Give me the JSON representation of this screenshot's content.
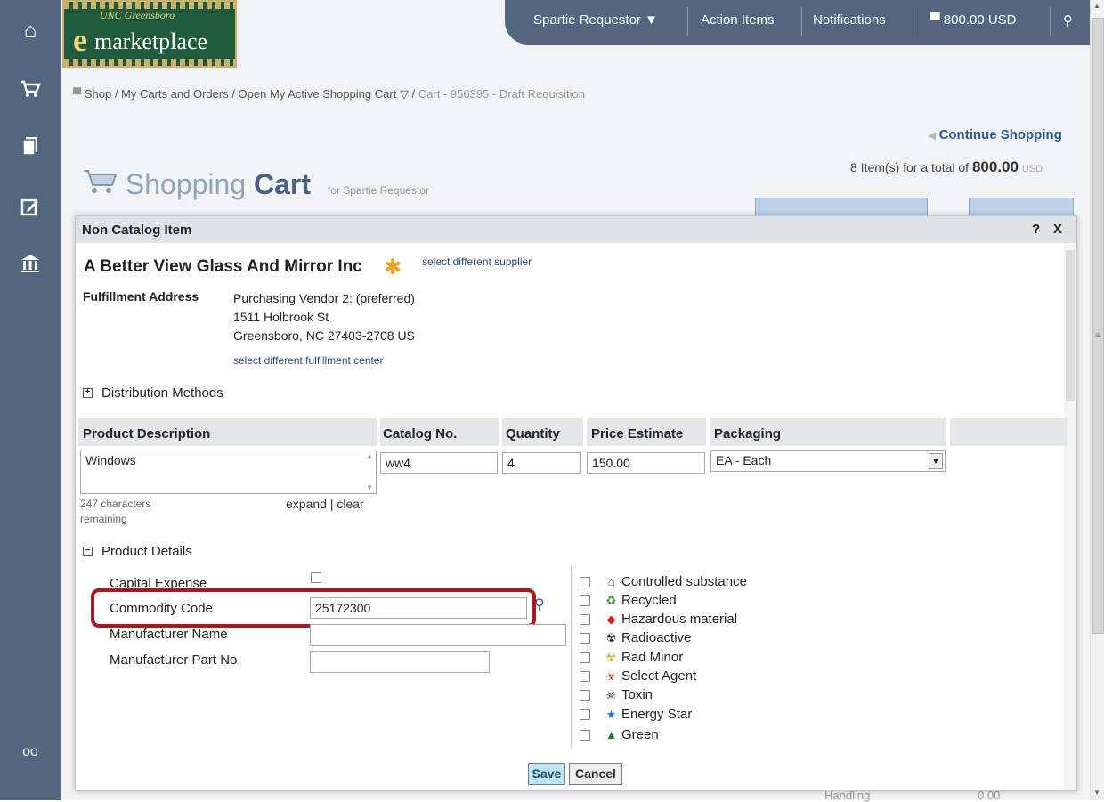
{
  "rail": {
    "icons": [
      "home-icon",
      "cart-icon",
      "documents-icon",
      "edit-icon",
      "bank-icon",
      "binoculars-icon"
    ]
  },
  "logo": {
    "sub": "UNC Greensboro",
    "e": "e",
    "main": "marketplace"
  },
  "topnav": {
    "user": "Spartie Requestor ▼",
    "action_items": "Action Items",
    "notifications": "Notifications",
    "cart_total": "800.00 USD"
  },
  "breadcrumb": {
    "shop": "Shop",
    "carts": "My Carts and Orders",
    "open_cart": "Open My Active Shopping Cart",
    "current": "Cart - 956395 - Draft Requisition"
  },
  "cart": {
    "continue": "Continue Shopping",
    "items_text": "8 Item(s)  for a total of",
    "total": "800.00",
    "currency": "USD",
    "title_light": "Shopping",
    "title_bold": "Cart",
    "for_text": "for Spartie Requestor"
  },
  "modal": {
    "title": "Non Catalog Item",
    "help": "?",
    "close": "X",
    "supplier": "A Better View Glass And Mirror Inc",
    "select_supplier": "select different supplier",
    "fulfillment_label": "Fulfillment Address",
    "fulfillment_lines": [
      "Purchasing Vendor 2: (preferred)",
      "1511 Holbrook St",
      "Greensboro, NC 27403-2708 US"
    ],
    "select_fulfillment": "select different fulfillment center",
    "distribution": "Distribution Methods",
    "table": {
      "headers": [
        "Product Description",
        "Catalog No.",
        "Quantity",
        "Price Estimate",
        "Packaging"
      ],
      "description": "Windows",
      "catalog_no": "ww4",
      "quantity": "4",
      "price": "150.00",
      "packaging": "EA - Each"
    },
    "remaining": "247 characters remaining",
    "remaining_l1": "247 characters",
    "remaining_l2": "remaining",
    "expand": "expand",
    "clear": "clear",
    "product_details": "Product Details",
    "details": {
      "capital_expense": "Capital Expense",
      "commodity_code": "Commodity Code",
      "commodity_value": "25172300",
      "manufacturer_name": "Manufacturer Name",
      "manufacturer_part": "Manufacturer Part No"
    },
    "attributes": [
      {
        "label": "Controlled substance",
        "icon": "controlled-substance-icon",
        "glyph": "⌂",
        "color": "#3a3a8a"
      },
      {
        "label": "Recycled",
        "icon": "recycled-icon",
        "glyph": "♻",
        "color": "#2a9a2a"
      },
      {
        "label": "Hazardous material",
        "icon": "hazardous-icon",
        "glyph": "◆",
        "color": "#d02020"
      },
      {
        "label": "Radioactive",
        "icon": "radioactive-icon",
        "glyph": "☢",
        "color": "#222"
      },
      {
        "label": "Rad Minor",
        "icon": "rad-minor-icon",
        "glyph": "☢",
        "color": "#c9b030"
      },
      {
        "label": "Select Agent",
        "icon": "select-agent-icon",
        "glyph": "☣",
        "color": "#b02020"
      },
      {
        "label": "Toxin",
        "icon": "toxin-icon",
        "glyph": "☠",
        "color": "#222"
      },
      {
        "label": "Energy Star",
        "icon": "energy-star-icon",
        "glyph": "★",
        "color": "#1a7ac9"
      },
      {
        "label": "Green",
        "icon": "green-icon",
        "glyph": "▲",
        "color": "#1a7a2a"
      }
    ],
    "save": "Save",
    "cancel": "Cancel"
  },
  "background": {
    "handling": "Handling",
    "handling_value": "0.00"
  }
}
